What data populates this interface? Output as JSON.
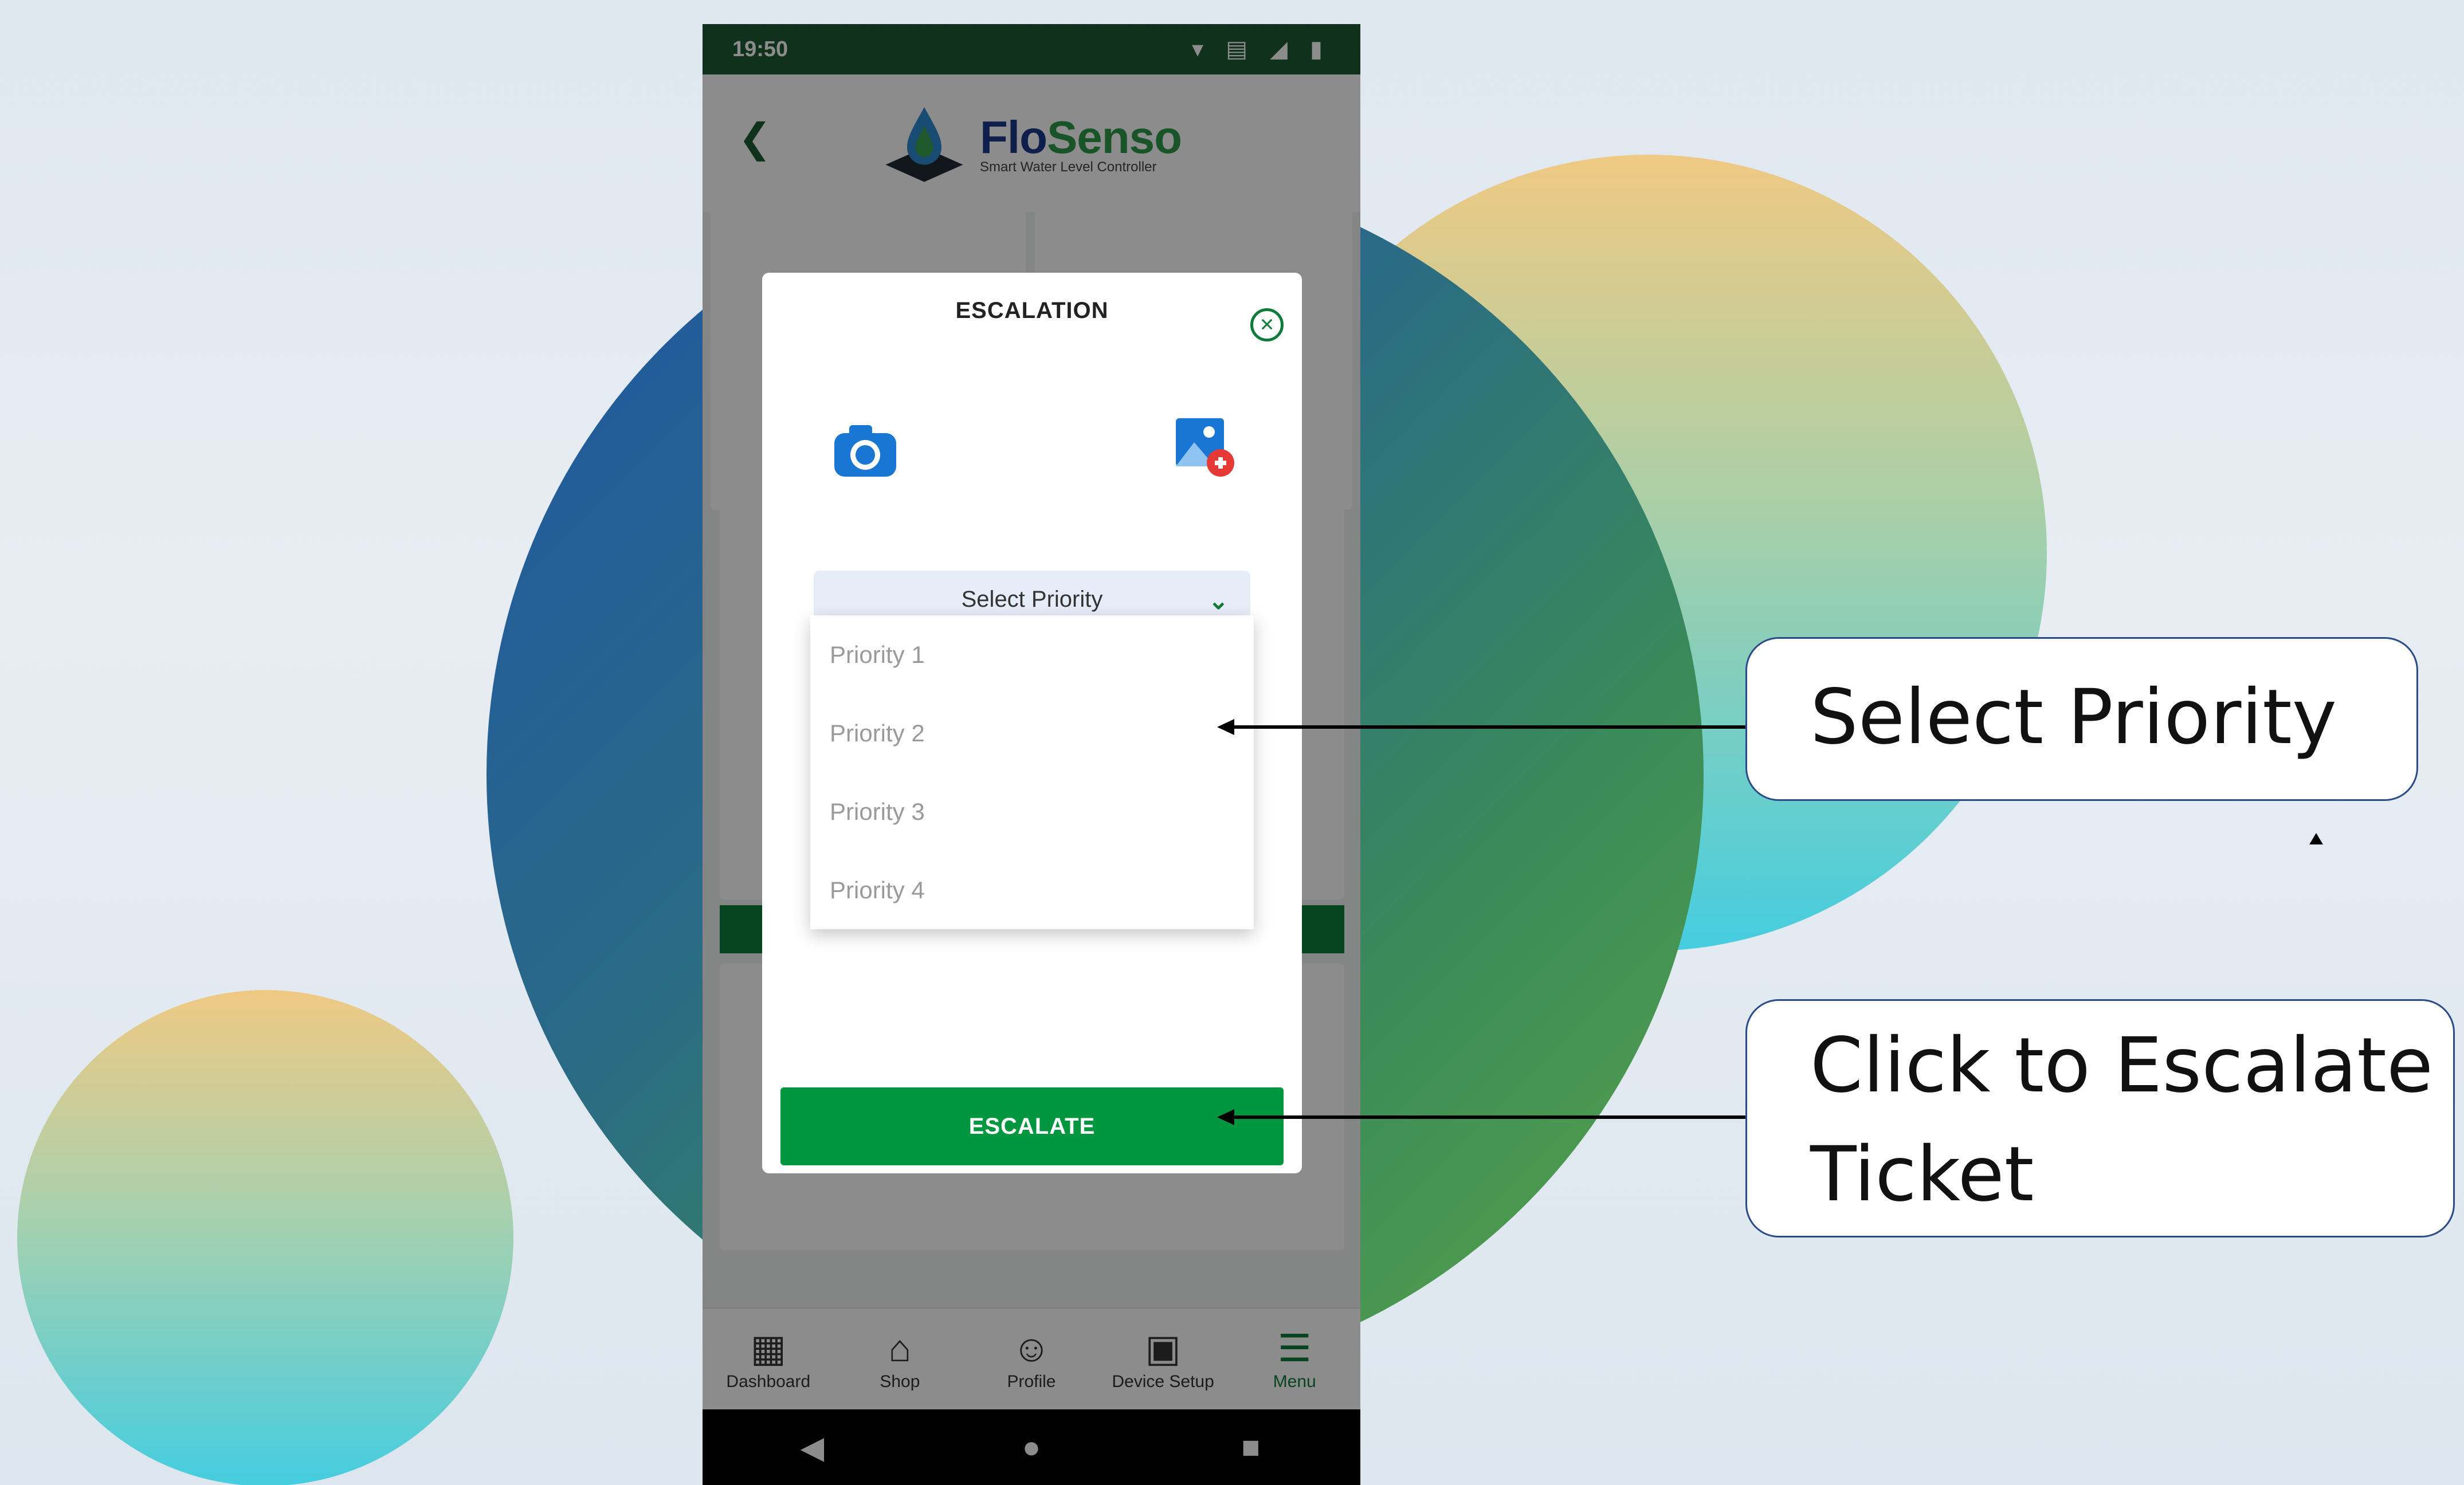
{
  "status_bar": {
    "time": "19:50",
    "icons": "▾ ▤ ◢ ▮"
  },
  "app": {
    "brand_part1": "Flo",
    "brand_part2": "Senso",
    "tagline": "Smart Water Level Controller"
  },
  "bottom_nav": [
    {
      "label": "Dashboard",
      "icon": "dashboard-icon",
      "glyph": "▦"
    },
    {
      "label": "Shop",
      "icon": "shopping-bag-icon",
      "glyph": "⌂"
    },
    {
      "label": "Profile",
      "icon": "person-icon",
      "glyph": "☺"
    },
    {
      "label": "Device Setup",
      "icon": "device-setup-icon",
      "glyph": "▣"
    },
    {
      "label": "Menu",
      "icon": "hamburger-menu-icon",
      "glyph": "☰",
      "active": true
    }
  ],
  "modal": {
    "title": "ESCALATION",
    "close_icon": "close-circle-icon",
    "select_placeholder": "Select Priority",
    "priority_options": [
      "Priority 1",
      "Priority 2",
      "Priority 3",
      "Priority 4"
    ],
    "escalate_label": "ESCALATE"
  },
  "callouts": {
    "select_priority": "Select Priority",
    "escalate_line1": "Click to Escalate",
    "escalate_line2": "Ticket"
  },
  "colors": {
    "header_green": "#1e5c36",
    "accent_green": "#00963f",
    "brand_blue": "#1a3a8a",
    "select_bg": "#e6edf8"
  }
}
